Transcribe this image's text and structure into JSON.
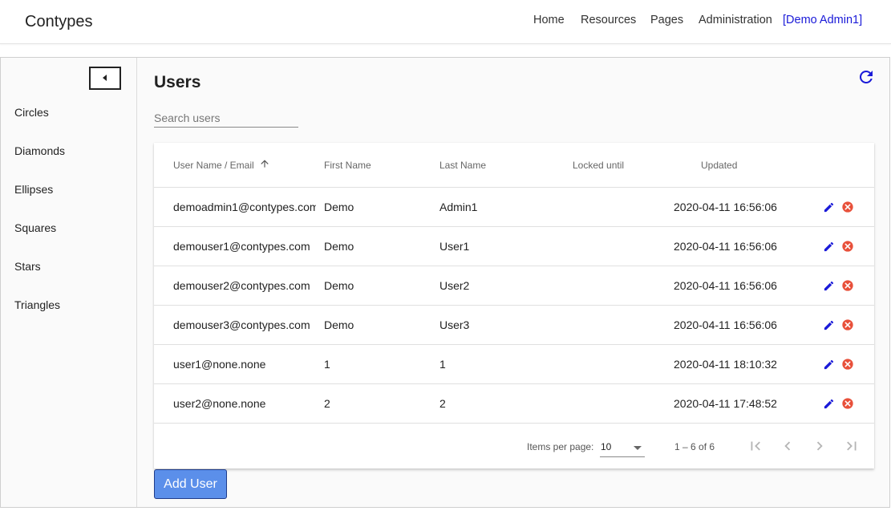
{
  "app": {
    "brand": "Contypes"
  },
  "nav": {
    "home": "Home",
    "resources": "Resources",
    "pages": "Pages",
    "administration": "Administration",
    "user": "[Demo Admin1]"
  },
  "sidebar": {
    "items": [
      {
        "label": "Circles"
      },
      {
        "label": "Diamonds"
      },
      {
        "label": "Ellipses"
      },
      {
        "label": "Squares"
      },
      {
        "label": "Stars"
      },
      {
        "label": "Triangles"
      }
    ]
  },
  "page": {
    "title": "Users"
  },
  "search": {
    "placeholder": "Search users",
    "value": ""
  },
  "table": {
    "columns": {
      "email": "User Name / Email",
      "first": "First Name",
      "last": "Last Name",
      "locked": "Locked until",
      "updated": "Updated"
    },
    "sort": {
      "column": "email",
      "direction": "ascending"
    },
    "rows": [
      {
        "email": "demoadmin1@contypes.com",
        "first": "Demo",
        "last": "Admin1",
        "locked": "",
        "updated": "2020-04-11 16:56:06"
      },
      {
        "email": "demouser1@contypes.com",
        "first": "Demo",
        "last": "User1",
        "locked": "",
        "updated": "2020-04-11 16:56:06"
      },
      {
        "email": "demouser2@contypes.com",
        "first": "Demo",
        "last": "User2",
        "locked": "",
        "updated": "2020-04-11 16:56:06"
      },
      {
        "email": "demouser3@contypes.com",
        "first": "Demo",
        "last": "User3",
        "locked": "",
        "updated": "2020-04-11 16:56:06"
      },
      {
        "email": "user1@none.none",
        "first": "1",
        "last": "1",
        "locked": "",
        "updated": "2020-04-11 18:10:32"
      },
      {
        "email": "user2@none.none",
        "first": "2",
        "last": "2",
        "locked": "",
        "updated": "2020-04-11 17:48:52"
      }
    ]
  },
  "paginator": {
    "items_per_page_label": "Items per page:",
    "items_per_page": "10",
    "range": "1 – 6 of 6"
  },
  "actions": {
    "add_user": "Add User"
  },
  "icons": {
    "collapse": "caret-left-icon",
    "refresh": "refresh-icon",
    "sort": "arrow-up-icon",
    "edit": "pencil-icon",
    "delete": "close-circle-icon",
    "first_page": "first-page-icon",
    "prev_page": "chevron-left-icon",
    "next_page": "chevron-right-icon",
    "last_page": "last-page-icon"
  },
  "colors": {
    "accent": "#1a1ad8",
    "delete": "#e8503a",
    "button": "#5b8fea",
    "disabled": "#b5b5b5"
  }
}
